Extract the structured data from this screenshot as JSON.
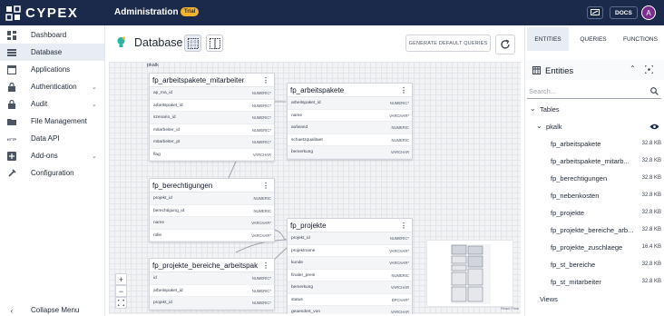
{
  "topbar": {
    "logo_text": "CYPEX",
    "title": "Administration",
    "trial_badge": "Trial",
    "docs_label": "DOCS",
    "avatar_initial": "A"
  },
  "sidebar": {
    "items": [
      {
        "label": "Dashboard",
        "icon": "dashboard-icon"
      },
      {
        "label": "Database",
        "icon": "database-icon"
      },
      {
        "label": "Applications",
        "icon": "applications-icon"
      },
      {
        "label": "Authentication",
        "icon": "lock-icon"
      },
      {
        "label": "Audit",
        "icon": "lock-icon"
      },
      {
        "label": "File Management",
        "icon": "folder-icon"
      },
      {
        "label": "Data API",
        "icon": "http-icon"
      },
      {
        "label": "Add-ons",
        "icon": "add-box-icon"
      },
      {
        "label": "Configuration",
        "icon": "gear-icon"
      }
    ],
    "active": "Database",
    "collapse_label": "Collapse Menu"
  },
  "main": {
    "title": "Database",
    "generate_label": "GENERATE DEFAULT QUERIES",
    "schema_label": "pkalk",
    "tables": [
      {
        "title": "fp_arbeitspakete_mitarbeiter",
        "columns": [
          {
            "name": "ap_ma_id",
            "type": "NUMERIC*"
          },
          {
            "name": "arbeitspaket_id",
            "type": "NUMERIC*"
          },
          {
            "name": "szenario_id",
            "type": "NUMERIC*"
          },
          {
            "name": "mitarbeiter_id",
            "type": "NUMERIC*"
          },
          {
            "name": "mitarbeiter_pt",
            "type": "NUMERIC*"
          },
          {
            "name": "flag",
            "type": "VARCHAR"
          }
        ]
      },
      {
        "title": "fp_arbeitspakete",
        "columns": [
          {
            "name": "arbeitspaket_id",
            "type": "NUMERIC*"
          },
          {
            "name": "name",
            "type": "VARCHAR*"
          },
          {
            "name": "aufwand",
            "type": "NUMERIC"
          },
          {
            "name": "schaetzqualitaet",
            "type": "NUMERIC"
          },
          {
            "name": "bemerkung",
            "type": "VARCHAR"
          }
        ]
      },
      {
        "title": "fp_berechtigungen",
        "columns": [
          {
            "name": "projekt_id",
            "type": "NUMERIC"
          },
          {
            "name": "berechtigung_id",
            "type": "NUMERIC"
          },
          {
            "name": "name",
            "type": "VARCHAR*"
          },
          {
            "name": "rolle",
            "type": "VARCHAR*"
          }
        ]
      },
      {
        "title": "fp_projekte",
        "columns": [
          {
            "name": "projekt_id",
            "type": "NUMERIC*"
          },
          {
            "name": "projektname",
            "type": "VARCHAR*"
          },
          {
            "name": "kunde",
            "type": "VARCHAR*"
          },
          {
            "name": "finaler_preis",
            "type": "NUMERIC"
          },
          {
            "name": "bemerkung",
            "type": "VARCHAR"
          },
          {
            "name": "status",
            "type": "BPCHAR*"
          },
          {
            "name": "geaendert_von",
            "type": "VARCHAR"
          }
        ]
      },
      {
        "title": "fp_projekte_bereiche_arbeitspak",
        "columns": [
          {
            "name": "id",
            "type": "NUMERIC*"
          },
          {
            "name": "arbeitspaket_id",
            "type": "NUMERIC*"
          },
          {
            "name": "projekt_id",
            "type": "NUMERIC*"
          }
        ]
      }
    ],
    "attribution": "React Flow"
  },
  "right_panel": {
    "tabs": [
      "ENTITIES",
      "QUERIES",
      "FUNCTIONS"
    ],
    "active_tab": "ENTITIES",
    "entities_title": "Entities",
    "search_placeholder": "Search...",
    "tables_label": "Tables",
    "schema_name": "pkalk",
    "entities": [
      {
        "name": "fp_arbeitspakete",
        "size": "32.8 KB"
      },
      {
        "name": "fp_arbeitspakete_mitarb...",
        "size": "32.8 KB"
      },
      {
        "name": "fp_berechtigungen",
        "size": "32.8 KB"
      },
      {
        "name": "fp_nebenkosten",
        "size": "32.8 KB"
      },
      {
        "name": "fp_projekte",
        "size": "32.8 KB"
      },
      {
        "name": "fp_projekte_bereiche_arb...",
        "size": "32.8 KB"
      },
      {
        "name": "fp_projekte_zuschlaege",
        "size": "16.4 KB"
      },
      {
        "name": "fp_st_bereiche",
        "size": "32.8 KB"
      },
      {
        "name": "fp_st_mitarbeiter",
        "size": "32.8 KB"
      }
    ],
    "views_label": "Views"
  }
}
